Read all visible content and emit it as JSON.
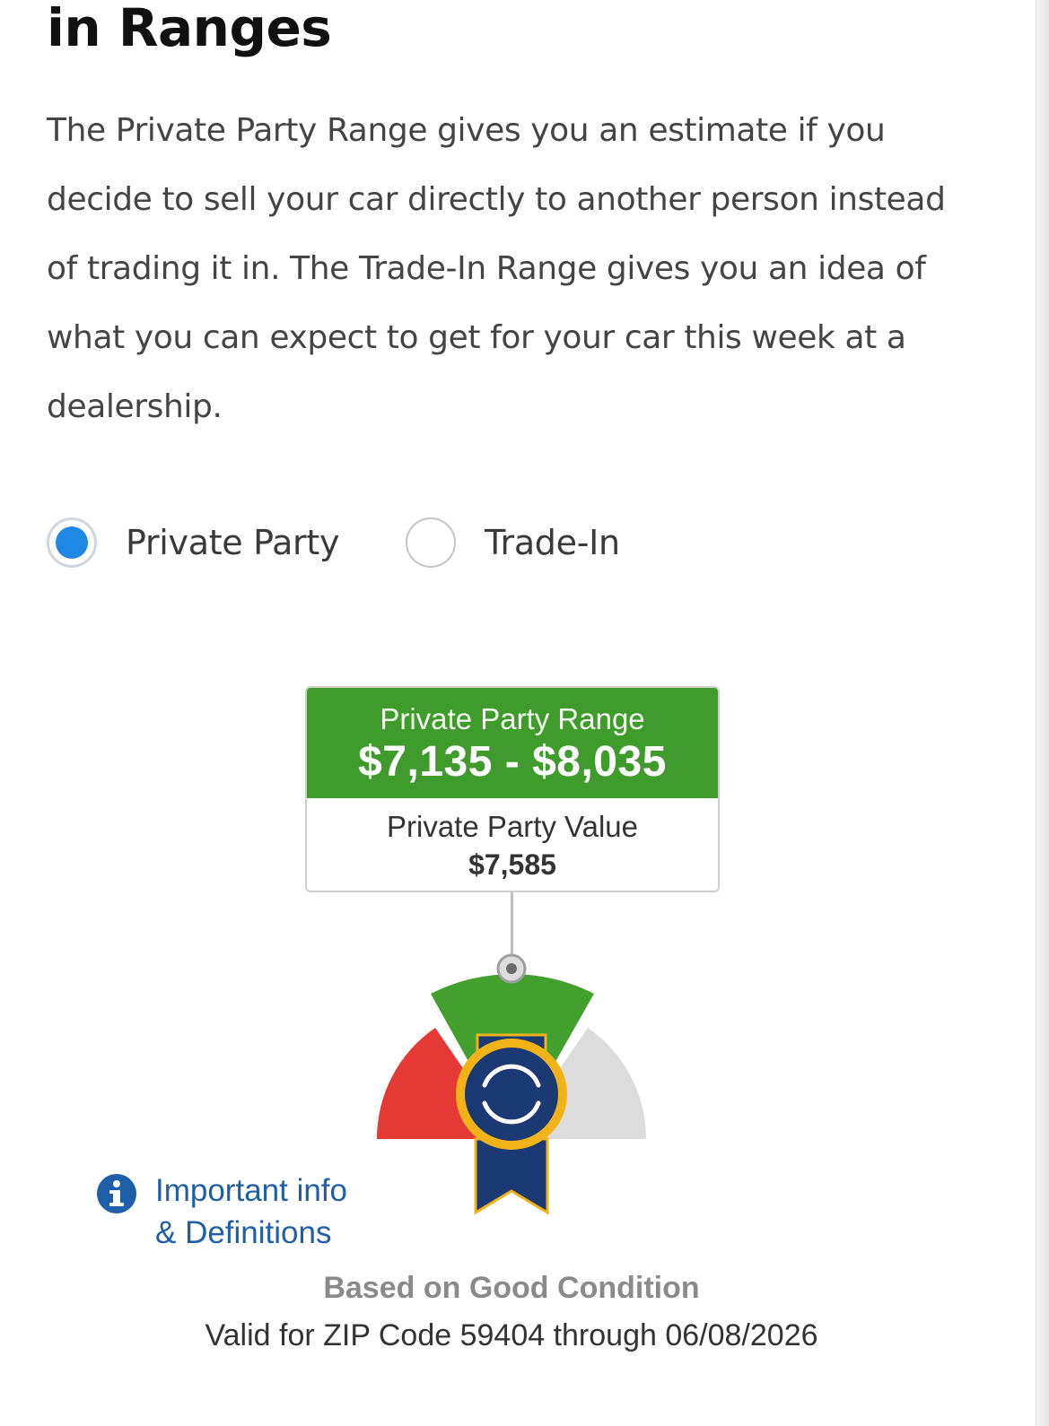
{
  "section": {
    "title": "in Ranges",
    "description": "The Private Party Range gives you an estimate if you decide to sell your car directly to another person instead of trading it in. The Trade-In Range gives you an idea of what you can expect to get for your car this week at a dealership."
  },
  "options": {
    "private_party": {
      "label": "Private Party",
      "selected": true
    },
    "trade_in": {
      "label": "Trade-In",
      "selected": false
    }
  },
  "range_card": {
    "range_label": "Private Party Range",
    "range_value": "$7,135 - $8,035",
    "value_label": "Private Party Value",
    "value_amount": "$7,585"
  },
  "gauge": {
    "icon": "ribbon-badge-icon",
    "colors": {
      "low": "#e53935",
      "target": "#43a02f",
      "high": "#dcdcdc",
      "badge": "#1b3a73",
      "badge_ring": "#f2b318"
    }
  },
  "info": {
    "line1": "Important info",
    "line2": "& Definitions",
    "icon": "info-icon"
  },
  "footer": {
    "condition": "Based on Good Condition",
    "validity": "Valid for ZIP Code 59404 through 06/08/2026"
  },
  "colors": {
    "accent_blue": "#1e88e5",
    "range_green": "#3f9b2c",
    "link_blue": "#1f5fa8"
  }
}
